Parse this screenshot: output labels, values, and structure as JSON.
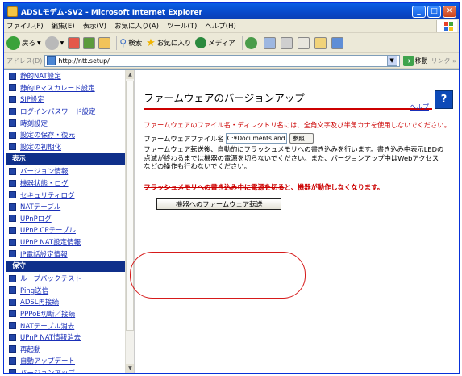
{
  "window": {
    "title": "ADSLモデム-SV2 - Microsoft Internet Explorer"
  },
  "menu": [
    "ファイル(F)",
    "編集(E)",
    "表示(V)",
    "お気に入り(A)",
    "ツール(T)",
    "ヘルプ(H)"
  ],
  "toolbar": {
    "back": "戻る",
    "search": "検索",
    "favorites": "お気に入り",
    "media": "メディア"
  },
  "address": {
    "label": "アドレス(D)",
    "url": "http://ntt.setup/",
    "go": "移動",
    "links": "リンク »"
  },
  "sidebar": {
    "top_items": [
      "静的NAT設定",
      "静的IPマスカレード設定",
      "SIP設定",
      "ログインパスワード設定",
      "時刻設定",
      "設定の保存・復元",
      "設定の初期化"
    ],
    "display_header": "表示",
    "display_items": [
      "バージョン情報",
      "機器状態・ログ",
      "セキュリティログ",
      "NATテーブル",
      "UPnPログ",
      "UPnP CPテーブル",
      "UPnP NAT設定情報",
      "IP電話設定情報"
    ],
    "maint_header": "保守",
    "maint_items": [
      "ループバックテスト",
      "Ping送信",
      "ADSL再接続",
      "PPPoE切断／接続",
      "NATテーブル消去",
      "UPnP NAT情報消去",
      "再起動",
      "自動アップデート",
      "バージョンアップ"
    ]
  },
  "main": {
    "title": "ファームウェアのバージョンアップ",
    "help": "ヘルプ",
    "warning": "ファームウェアのファイル名・ディレクトリ名には、全角文字及び半角カナを使用しないでください。",
    "file_label": "ファームウェアファイル名",
    "file_value": "C:¥Documents and S",
    "browse": "参照...",
    "note": "ファームウェア転送後、自動的にフラッシュメモリへの書き込みを行います。書き込み中表示LEDの点滅が終わるまでは機器の電源を切らないでください。また、バージョンアップ中はWebアクセスなどの操作も行わないでください。",
    "strike_a": "フラッシュメモリへの書き込み中に電源を切る",
    "strike_b": "と、機器が動作しなくなります。",
    "transfer_button": "機器へのファームウェア転送"
  },
  "colors": {
    "highlight": "#d61a1a",
    "warning": "#cc0000",
    "title_rule": "#cc0000",
    "section_header": "#0f2f8a"
  }
}
